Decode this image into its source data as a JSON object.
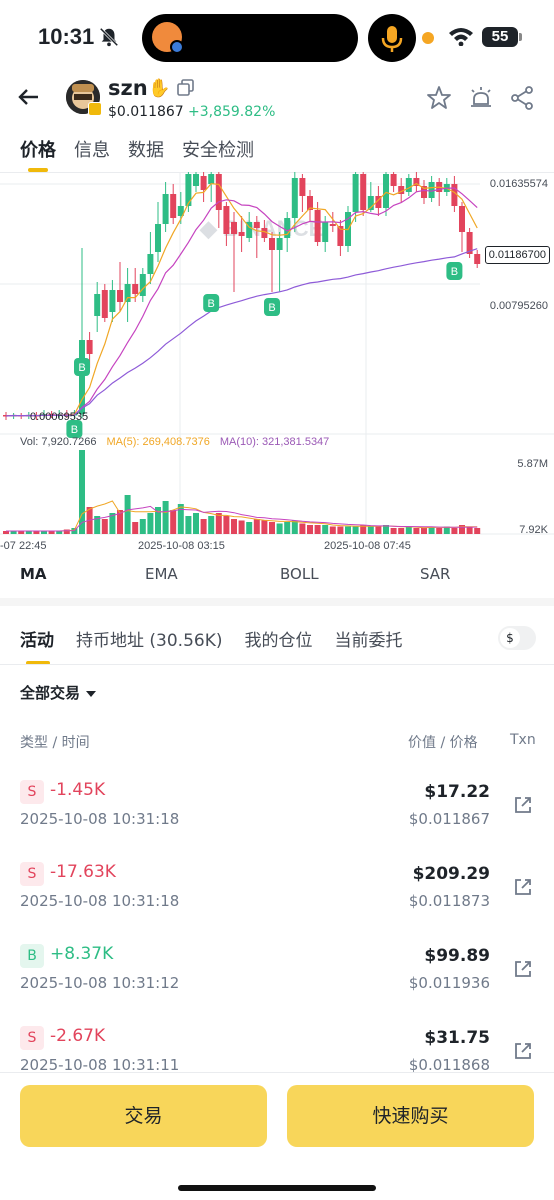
{
  "status_bar": {
    "time": "10:31",
    "battery": "55"
  },
  "header": {
    "token_name": "szn",
    "price": "$0.011867",
    "change": "+3,859.82%"
  },
  "tabs": [
    {
      "label": "价格",
      "active": true
    },
    {
      "label": "信息",
      "active": false
    },
    {
      "label": "数据",
      "active": false
    },
    {
      "label": "安全检测",
      "active": false
    }
  ],
  "chart": {
    "price_labels": {
      "high": "0.01635574",
      "current": "0.01186700",
      "mid": "0.00795260",
      "min": "0.00069535"
    },
    "volume": {
      "label": "Vol: 7,920.7266",
      "ma5": "MA(5): 269,408.7376",
      "ma10": "MA(10): 321,381.5347",
      "max": "5.87M",
      "min": "7.92K"
    },
    "time_labels": [
      "-07 22:45",
      "2025-10-08 03:15",
      "2025-10-08 07:45"
    ],
    "buy_marker": "B",
    "colors": {
      "up": "#2ebd85",
      "down": "#e2445c",
      "ma5": "#f0a726",
      "ma10": "#c644c0",
      "ma30": "#8e5bd8"
    }
  },
  "indicators": [
    {
      "label": "MA",
      "active": true
    },
    {
      "label": "EMA",
      "active": false
    },
    {
      "label": "BOLL",
      "active": false
    },
    {
      "label": "SAR",
      "active": false
    }
  ],
  "activity_tabs": [
    {
      "label": "活动",
      "active": true
    },
    {
      "label": "持币地址 (30.56K)",
      "active": false
    },
    {
      "label": "我的仓位",
      "active": false
    },
    {
      "label": "当前委托",
      "active": false
    }
  ],
  "currency_toggle": "$",
  "filter": "全部交易",
  "columns": {
    "type_time": "类型 / 时间",
    "value_price": "价值 / 价格",
    "txn": "Txn"
  },
  "trades": [
    {
      "side": "S",
      "amount": "-1.45K",
      "time": "2025-10-08 10:31:18",
      "value": "$17.22",
      "price": "$0.011867"
    },
    {
      "side": "S",
      "amount": "-17.63K",
      "time": "2025-10-08 10:31:18",
      "value": "$209.29",
      "price": "$0.011873"
    },
    {
      "side": "B",
      "amount": "+8.37K",
      "time": "2025-10-08 10:31:12",
      "value": "$99.89",
      "price": "$0.011936"
    },
    {
      "side": "S",
      "amount": "-2.67K",
      "time": "2025-10-08 10:31:11",
      "value": "$31.75",
      "price": "$0.011868"
    }
  ],
  "buttons": {
    "trade": "交易",
    "quick_buy": "快速购买"
  }
}
